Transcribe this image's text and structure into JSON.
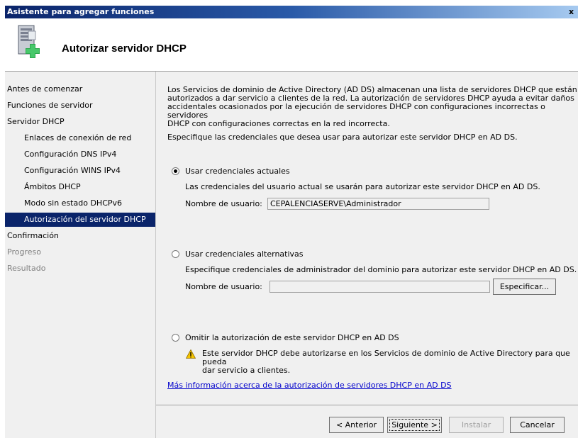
{
  "window": {
    "title": "Asistente para agregar funciones",
    "close_glyph": "x"
  },
  "header": {
    "title": "Autorizar servidor DHCP",
    "icon": "server-add-icon"
  },
  "nav": {
    "items": [
      {
        "label": "Antes de comenzar",
        "state": "normal",
        "level": 0
      },
      {
        "label": "Funciones de servidor",
        "state": "normal",
        "level": 0
      },
      {
        "label": "Servidor DHCP",
        "state": "normal",
        "level": 0
      },
      {
        "label": "Enlaces de conexión de red",
        "state": "normal",
        "level": 1
      },
      {
        "label": "Configuración DNS IPv4",
        "state": "normal",
        "level": 1
      },
      {
        "label": "Configuración WINS IPv4",
        "state": "normal",
        "level": 1
      },
      {
        "label": "Ámbitos DHCP",
        "state": "normal",
        "level": 1
      },
      {
        "label": "Modo sin estado DHCPv6",
        "state": "normal",
        "level": 1
      },
      {
        "label": "Autorización del servidor DHCP",
        "state": "selected",
        "level": 1
      },
      {
        "label": "Confirmación",
        "state": "normal",
        "level": 0
      },
      {
        "label": "Progreso",
        "state": "disabled",
        "level": 0
      },
      {
        "label": "Resultado",
        "state": "disabled",
        "level": 0
      }
    ]
  },
  "content": {
    "intro_lines": [
      "Los Servicios de dominio de Active Directory (AD DS) almacenan una lista de servidores DHCP que están",
      "autorizados a dar servicio a clientes de la red. La autorización de servidores DHCP ayuda a evitar daños",
      "accidentales ocasionados por la ejecución de servidores DHCP con configuraciones incorrectas o servidores",
      "DHCP con configuraciones correctas en la red incorrecta."
    ],
    "instruction": "Especifique las credenciales que desea usar para autorizar este servidor DHCP en AD DS.",
    "option_current": {
      "label": "Usar credenciales actuales",
      "selected": true,
      "description": "Las credenciales del usuario actual se usarán para autorizar este servidor DHCP en AD DS.",
      "user_label": "Nombre de usuario:",
      "user_value": "CEPALENCIASERVE\\Administrador"
    },
    "option_alt": {
      "label": "Usar credenciales alternativas",
      "selected": false,
      "description": "Especifique credenciales de administrador del dominio para autorizar este servidor DHCP en AD DS.",
      "user_label": "Nombre de usuario:",
      "user_value": "",
      "specify_button": "Especificar..."
    },
    "option_skip": {
      "label": "Omitir la autorización de este servidor DHCP en AD DS",
      "selected": false,
      "warning_line1": "Este servidor DHCP debe autorizarse en los Servicios de dominio de Active Directory para que pueda",
      "warning_line2": "dar servicio a clientes.",
      "warning_icon": "warning-icon"
    },
    "more_info_link": "Más información acerca de la autorización de servidores DHCP en AD DS"
  },
  "footer": {
    "back": "< Anterior",
    "next": "Siguiente >",
    "install": "Instalar",
    "cancel": "Cancelar"
  },
  "colors": {
    "selection": "#0a246a",
    "link": "#0000cc",
    "disabled_text": "#808080",
    "warning": "#f5c400"
  }
}
